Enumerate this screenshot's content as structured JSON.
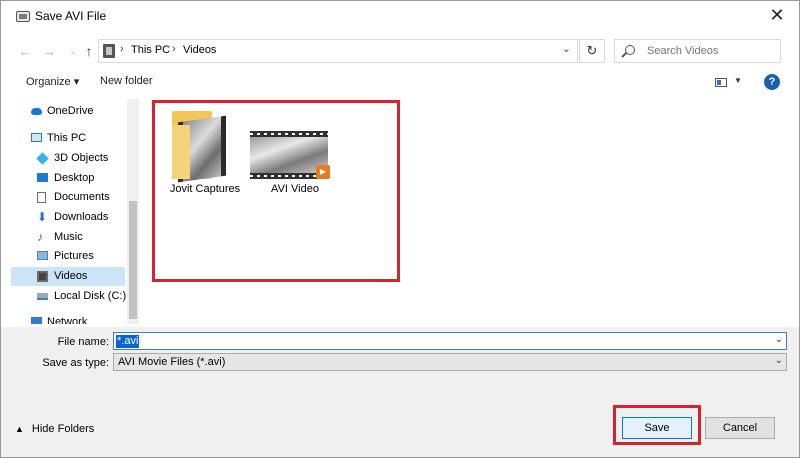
{
  "window": {
    "title": "Save AVI File",
    "close_glyph": "✕"
  },
  "nav": {
    "back_glyph": "←",
    "forward_glyph": "→",
    "recent_glyph": "⌄",
    "up_glyph": "↑",
    "breadcrumb": [
      "This PC",
      "Videos"
    ],
    "crumb_sep": "›",
    "dropdown_glyph": "⌄",
    "refresh_glyph": "↻",
    "search_placeholder": "Search Videos"
  },
  "toolbar": {
    "organize_label": "Organize ▾",
    "new_folder_label": "New folder",
    "view_dd_glyph": "▼",
    "help_glyph": "?"
  },
  "sidebar": {
    "items": [
      {
        "label": "OneDrive",
        "icon": "onedrive-icon"
      },
      {
        "label": "This PC",
        "icon": "pc-icon"
      },
      {
        "label": "3D Objects",
        "icon": "3d-objects-icon"
      },
      {
        "label": "Desktop",
        "icon": "desktop-icon"
      },
      {
        "label": "Documents",
        "icon": "documents-icon"
      },
      {
        "label": "Downloads",
        "icon": "downloads-icon",
        "glyph": "⬇"
      },
      {
        "label": "Music",
        "icon": "music-icon",
        "glyph": "♪"
      },
      {
        "label": "Pictures",
        "icon": "pictures-icon"
      },
      {
        "label": "Videos",
        "icon": "videos-icon",
        "selected": true
      },
      {
        "label": "Local Disk (C:)",
        "icon": "local-disk-icon"
      },
      {
        "label": "Network",
        "icon": "network-icon"
      }
    ]
  },
  "files": [
    {
      "label": "Jovit Captures",
      "icon": "folder-icon"
    },
    {
      "label": "AVI Video",
      "icon": "video-file-icon",
      "badge_glyph": "▶"
    }
  ],
  "form": {
    "file_name_label": "File name:",
    "file_name_value": "*.avi",
    "save_type_label": "Save as type:",
    "save_type_value": "AVI Movie Files (*.avi)",
    "dropdown_glyph": "⌄"
  },
  "footer": {
    "hide_folders_label": "Hide Folders",
    "hide_chevron": "▲",
    "save_label": "Save",
    "cancel_label": "Cancel"
  },
  "colors": {
    "highlight": "#d4242d",
    "accent": "#0078d7",
    "selection": "#cce4f7"
  }
}
